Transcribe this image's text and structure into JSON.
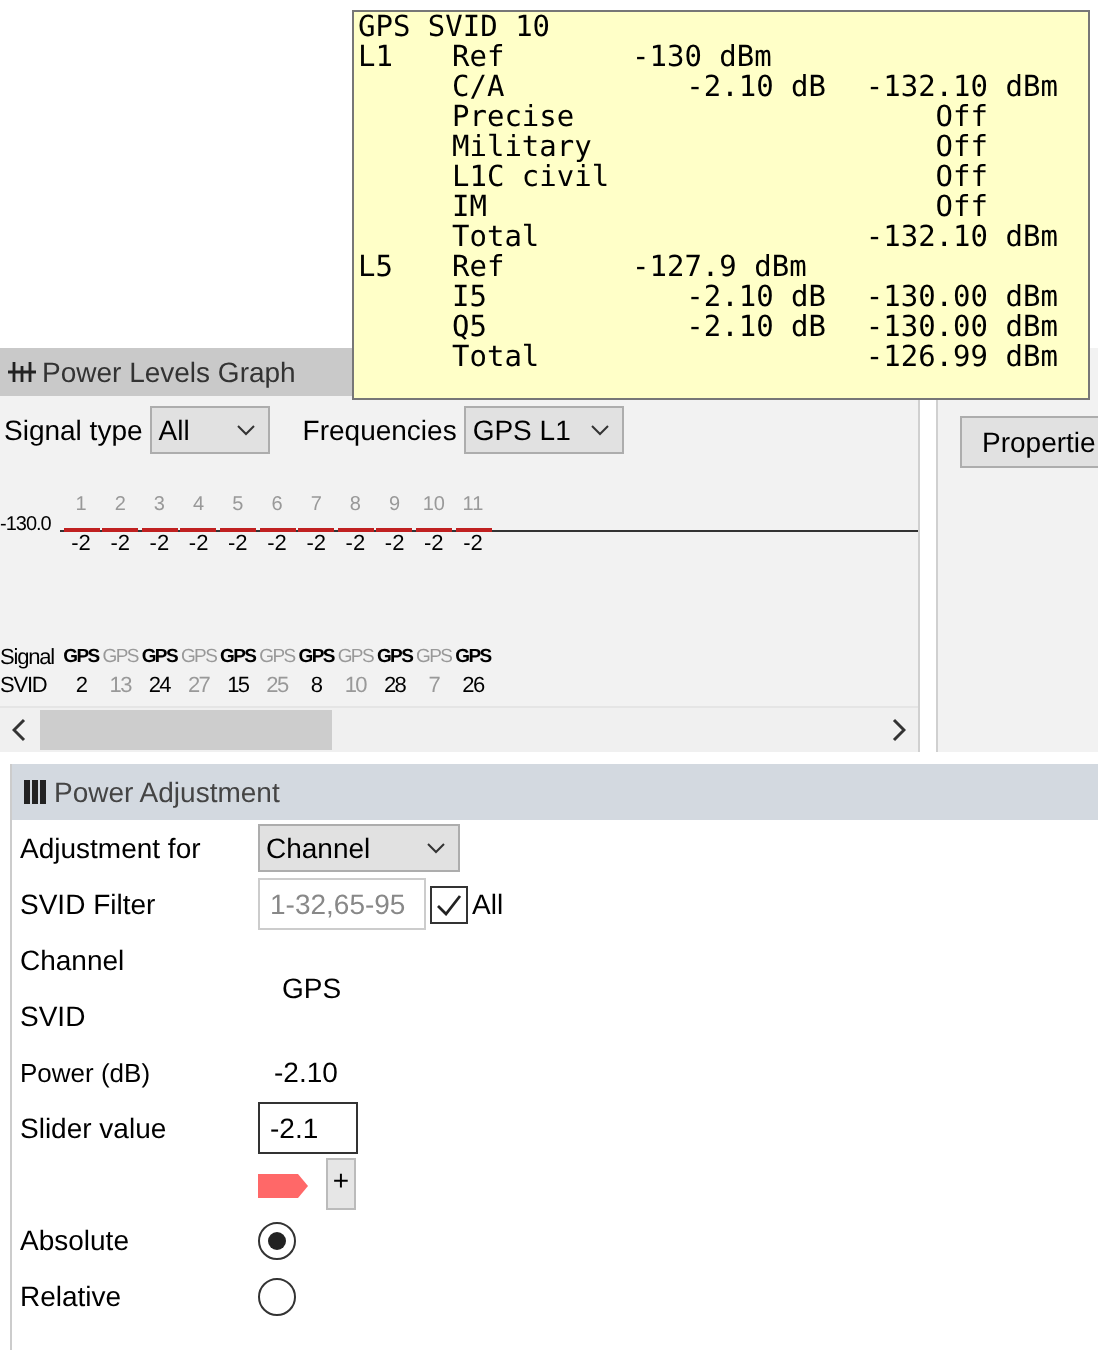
{
  "tooltip": {
    "title": "GPS SVID 10",
    "rows": [
      {
        "band": "L1",
        "label": "Ref",
        "ref": "-130 dBm"
      },
      {
        "label": "C/A",
        "gain": "-2.10 dB",
        "total": "-132.10",
        "unit": "dBm"
      },
      {
        "label": "Precise",
        "total": "Off"
      },
      {
        "label": "Military",
        "total": "Off"
      },
      {
        "label": "L1C civil",
        "total": "Off"
      },
      {
        "label": "IM",
        "total": "Off"
      },
      {
        "label": "Total",
        "total": "-132.10",
        "unit": "dBm"
      },
      {
        "band": "L5",
        "label": "Ref",
        "ref": "-127.9 dBm"
      },
      {
        "label": "I5",
        "gain": "-2.10 dB",
        "total": "-130.00",
        "unit": "dBm"
      },
      {
        "label": "Q5",
        "gain": "-2.10 dB",
        "total": "-130.00",
        "unit": "dBm"
      },
      {
        "label": "Total",
        "total": "-126.99",
        "unit": "dBm"
      }
    ]
  },
  "graph_panel": {
    "title": "Power Levels Graph",
    "signal_type_label": "Signal type",
    "signal_type": "All",
    "frequencies_label": "Frequencies",
    "frequency": "GPS L1",
    "axis_label": "-130.0",
    "signal_label": "Signal",
    "svid_label": "SVID",
    "channels": [
      {
        "number": "1",
        "value": "-2",
        "signal": "GPS",
        "svid": "2",
        "highlighted": true
      },
      {
        "number": "2",
        "value": "-2",
        "signal": "GPS",
        "svid": "13",
        "highlighted": false
      },
      {
        "number": "3",
        "value": "-2",
        "signal": "GPS",
        "svid": "24",
        "highlighted": true
      },
      {
        "number": "4",
        "value": "-2",
        "signal": "GPS",
        "svid": "27",
        "highlighted": false
      },
      {
        "number": "5",
        "value": "-2",
        "signal": "GPS",
        "svid": "15",
        "highlighted": true
      },
      {
        "number": "6",
        "value": "-2",
        "signal": "GPS",
        "svid": "25",
        "highlighted": false
      },
      {
        "number": "7",
        "value": "-2",
        "signal": "GPS",
        "svid": "8",
        "highlighted": true
      },
      {
        "number": "8",
        "value": "-2",
        "signal": "GPS",
        "svid": "10",
        "highlighted": false
      },
      {
        "number": "9",
        "value": "-2",
        "signal": "GPS",
        "svid": "28",
        "highlighted": true
      },
      {
        "number": "10",
        "value": "-2",
        "signal": "GPS",
        "svid": "7",
        "highlighted": false
      },
      {
        "number": "11",
        "value": "-2",
        "signal": "GPS",
        "svid": "26",
        "highlighted": true
      }
    ]
  },
  "side_panel": {
    "button": "Propertie"
  },
  "power_adjustment": {
    "title": "Power Adjustment",
    "adjustment_for_label": "Adjustment for",
    "adjustment_for": "Channel",
    "svid_filter_label": "SVID Filter",
    "svid_filter": "1-32,65-95",
    "all_label": "All",
    "all_checked": true,
    "channel_label": "Channel",
    "svid_label": "SVID",
    "channel_value": "GPS",
    "power_label": "Power (dB)",
    "power": "-2.10",
    "slider_label": "Slider value",
    "slider_value": "-2.1",
    "plus": "+",
    "modes": [
      {
        "label": "Absolute",
        "selected": true
      },
      {
        "label": "Relative",
        "selected": false
      }
    ]
  }
}
